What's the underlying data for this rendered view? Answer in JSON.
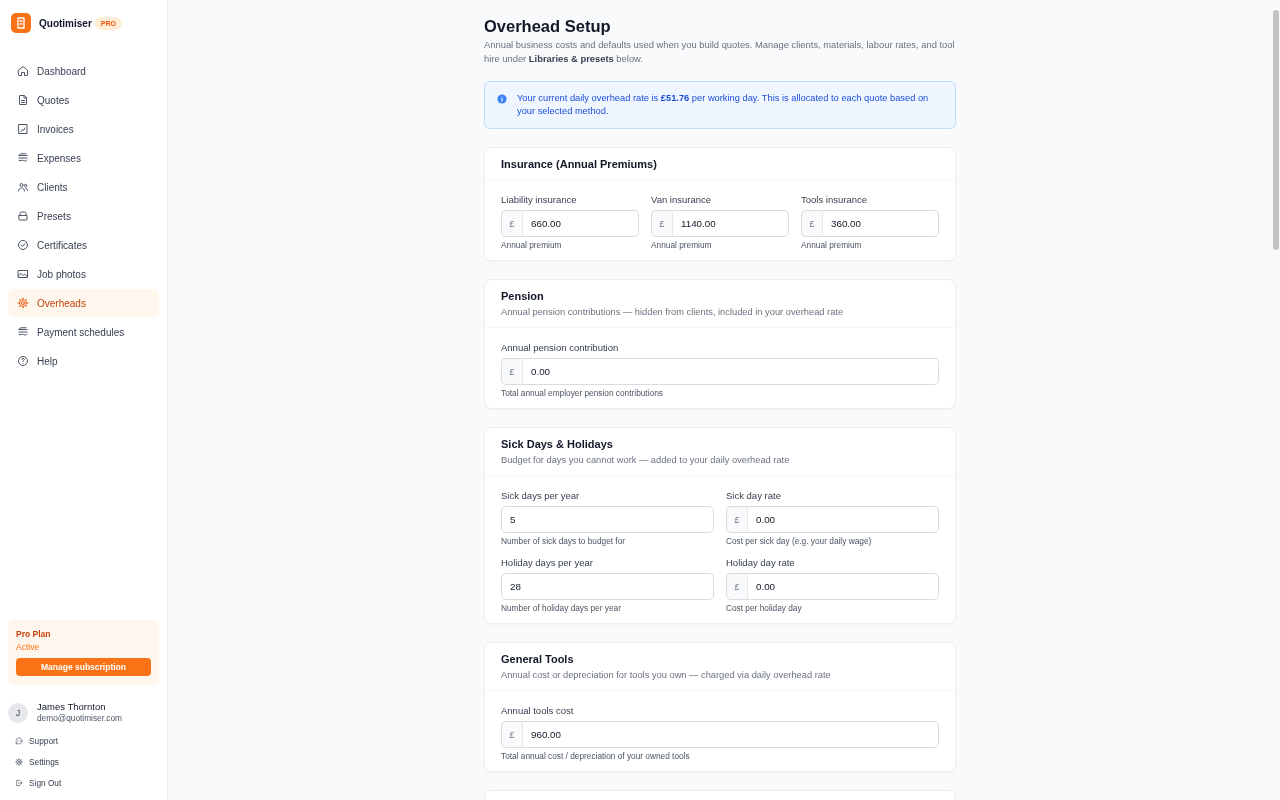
{
  "sidebar": {
    "brand": {
      "name": "Quotimiser",
      "badge": "PRO"
    },
    "nav_items": [
      {
        "label": "Dashboard",
        "selected": false
      },
      {
        "label": "Quotes",
        "selected": false
      },
      {
        "label": "Invoices",
        "selected": false
      },
      {
        "label": "Expenses",
        "selected": false
      },
      {
        "label": "Clients",
        "selected": false
      },
      {
        "label": "Presets",
        "selected": false
      },
      {
        "label": "Certificates",
        "selected": false
      },
      {
        "label": "Job photos",
        "selected": false
      },
      {
        "label": "Overheads",
        "selected": true
      },
      {
        "label": "Payment schedules",
        "selected": false
      },
      {
        "label": "Help",
        "selected": false
      }
    ],
    "plan": {
      "title": "Pro Plan",
      "status": "Active",
      "button": "Manage subscription"
    },
    "user": {
      "initial": "J",
      "name": "James Thornton",
      "email": "demo@quotimiser.com"
    },
    "footer_links": [
      {
        "label": "Support"
      },
      {
        "label": "Settings"
      },
      {
        "label": "Sign Out"
      }
    ]
  },
  "page": {
    "title": "Overhead Setup",
    "description": "Annual business costs and defaults used when you build quotes. Manage clients, materials, labour rates, and tool hire under **Libraries & presets** below."
  },
  "info_banner": {
    "text": "Your current daily overhead rate is **£51.76** per working day. This is allocated to each quote based on your selected method."
  },
  "sections": [
    {
      "title": "Insurance (Annual Premiums)",
      "rows": [
        [
          {
            "label": "Liability insurance",
            "prefix": "£",
            "value": "660.00",
            "hint": "Annual premium"
          },
          {
            "label": "Van insurance",
            "prefix": "£",
            "value": "1140.00",
            "hint": "Annual premium"
          },
          {
            "label": "Tools insurance",
            "prefix": "£",
            "value": "360.00",
            "hint": "Annual premium"
          }
        ]
      ]
    },
    {
      "title": "Pension",
      "description": "Annual pension contributions — hidden from clients, included in your overhead rate",
      "rows": [
        [
          {
            "label": "Annual pension contribution",
            "prefix": "£",
            "value": "0.00",
            "hint": "Total annual employer pension contributions"
          }
        ]
      ]
    },
    {
      "title": "Sick Days & Holidays",
      "description": "Budget for days you cannot work — added to your daily overhead rate",
      "rows": [
        [
          {
            "label": "Sick days per year",
            "value": "5",
            "hint": "Number of sick days to budget for"
          },
          {
            "label": "Sick day rate",
            "prefix": "£",
            "value": "0.00",
            "hint": "Cost per sick day (e.g. your daily wage)"
          }
        ],
        [
          {
            "label": "Holiday days per year",
            "value": "28",
            "hint": "Number of holiday days per year"
          },
          {
            "label": "Holiday day rate",
            "prefix": "£",
            "value": "0.00",
            "hint": "Cost per holiday day"
          }
        ]
      ]
    },
    {
      "title": "General Tools",
      "description": "Annual cost or depreciation for tools you own — charged via daily overhead rate",
      "rows": [
        [
          {
            "label": "Annual tools cost",
            "prefix": "£",
            "value": "960.00",
            "hint": "Total annual cost / depreciation of your owned tools"
          }
        ]
      ]
    }
  ]
}
